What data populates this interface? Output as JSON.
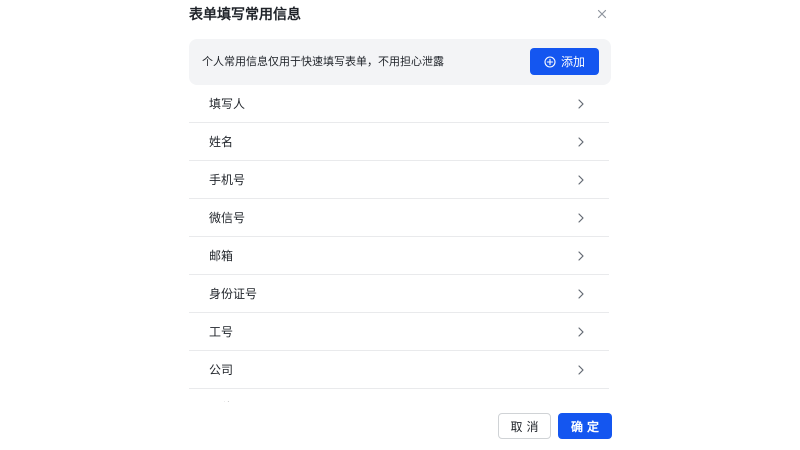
{
  "dialog": {
    "title": "表单填写常用信息"
  },
  "banner": {
    "text": "个人常用信息仅用于快速填写表单，不用担心泄露",
    "add_label": "添加"
  },
  "fields": [
    {
      "label": "填写人"
    },
    {
      "label": "姓名"
    },
    {
      "label": "手机号"
    },
    {
      "label": "微信号"
    },
    {
      "label": "邮箱"
    },
    {
      "label": "身份证号"
    },
    {
      "label": "工号"
    },
    {
      "label": "公司"
    },
    {
      "label": "职位"
    }
  ],
  "footer": {
    "cancel_label": "取消",
    "confirm_label": "确定"
  },
  "colors": {
    "accent": "#1456f0",
    "banner_bg": "#f3f4f6",
    "divider": "#e9eaec"
  },
  "icons": {
    "close": "close-icon",
    "add": "plus-circle-icon",
    "chevron": "chevron-right-icon"
  }
}
